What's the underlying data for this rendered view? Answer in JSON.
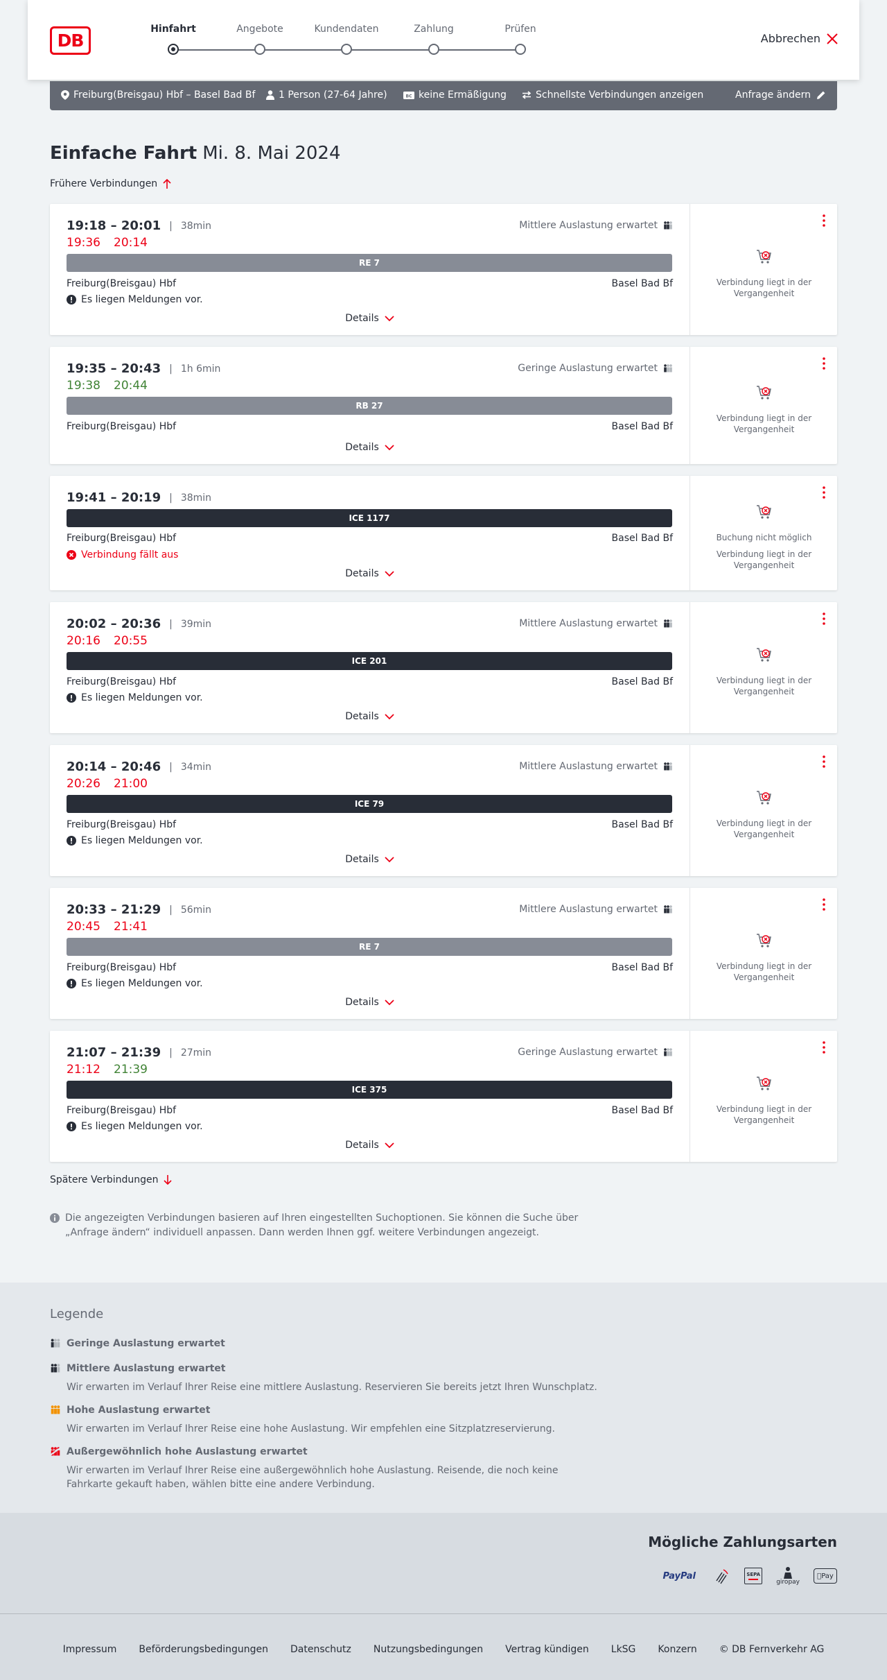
{
  "header": {
    "logo": "DB",
    "steps": [
      "Hinfahrt",
      "Angebote",
      "Kundendaten",
      "Zahlung",
      "Prüfen"
    ],
    "active_step": "Hinfahrt",
    "cancel_label": "Abbrechen"
  },
  "query": {
    "route": "Freiburg(Breisgau) Hbf – Basel Bad Bf",
    "passengers": "1 Person (27-64 Jahre)",
    "discount": "keine Ermäßigung",
    "fastest": "Schnellste Verbindungen anzeigen",
    "edit_label": "Anfrage ändern"
  },
  "title": {
    "trip_type": "Einfache Fahrt",
    "date": "Mi. 8. Mai 2024"
  },
  "earlier_label": "Frühere Verbindungen",
  "later_label": "Spätere Verbindungen",
  "details_label": "Details",
  "connections": [
    {
      "times": "19:18 – 20:01",
      "duration": "38min",
      "rt_dep": "19:36",
      "rt_arr": "20:14",
      "rt_color": "red",
      "load": "Mittlere Auslastung erwartet",
      "train": "RE 7",
      "train_style": "grey",
      "from": "Freiburg(Breisgau) Hbf",
      "to": "Basel Bad Bf",
      "msg": "Es liegen Meldungen vor.",
      "side": "Verbindung liegt in der Vergangenheit"
    },
    {
      "times": "19:35 – 20:43",
      "duration": "1h 6min",
      "rt_dep": "19:38",
      "rt_arr": "20:44",
      "rt_color": "green",
      "load": "Geringe Auslastung erwartet",
      "train": "RB 27",
      "train_style": "grey",
      "from": "Freiburg(Breisgau) Hbf",
      "to": "Basel Bad Bf",
      "side": "Verbindung liegt in der Vergangenheit"
    },
    {
      "times": "19:41 – 20:19",
      "duration": "38min",
      "train": "ICE 1177",
      "train_style": "dark",
      "from": "Freiburg(Breisgau) Hbf",
      "to": "Basel Bad Bf",
      "msg": "Verbindung fällt aus",
      "side_top": "Buchung nicht möglich",
      "side": "Verbindung liegt in der Vergangenheit"
    },
    {
      "times": "20:02 – 20:36",
      "duration": "39min",
      "rt_dep": "20:16",
      "rt_arr": "20:55",
      "rt_color": "red",
      "load": "Mittlere Auslastung erwartet",
      "train": "ICE 201",
      "train_style": "dark",
      "from": "Freiburg(Breisgau) Hbf",
      "to": "Basel Bad Bf",
      "msg": "Es liegen Meldungen vor.",
      "side": "Verbindung liegt in der Vergangenheit"
    },
    {
      "times": "20:14 – 20:46",
      "duration": "34min",
      "rt_dep": "20:26",
      "rt_arr": "21:00",
      "rt_color": "red",
      "load": "Mittlere Auslastung erwartet",
      "train": "ICE 79",
      "train_style": "dark",
      "from": "Freiburg(Breisgau) Hbf",
      "to": "Basel Bad Bf",
      "msg": "Es liegen Meldungen vor.",
      "side": "Verbindung liegt in der Vergangenheit"
    },
    {
      "times": "20:33 – 21:29",
      "duration": "56min",
      "rt_dep": "20:45",
      "rt_arr": "21:41",
      "rt_color": "red",
      "load": "Mittlere Auslastung erwartet",
      "train": "RE 7",
      "train_style": "grey",
      "from": "Freiburg(Breisgau) Hbf",
      "to": "Basel Bad Bf",
      "msg": "Es liegen Meldungen vor.",
      "side": "Verbindung liegt in der Vergangenheit"
    },
    {
      "times": "21:07 – 21:39",
      "duration": "27min",
      "rt_dep": "21:12",
      "rt_arr": "21:39",
      "rt_color": "mixed",
      "load": "Geringe Auslastung erwartet",
      "train": "ICE 375",
      "train_style": "dark",
      "from": "Freiburg(Breisgau) Hbf",
      "to": "Basel Bad Bf",
      "msg": "Es liegen Meldungen vor.",
      "side": "Verbindung liegt in der Vergangenheit"
    }
  ],
  "info_note": "Die angezeigten Verbindungen basieren auf Ihren eingestellten Suchoptionen. Sie können die Suche über „Anfrage ändern“ individuell anpassen. Dann werden Ihnen ggf. weitere Verbindungen angezeigt.",
  "legend": {
    "title": "Legende",
    "items": [
      {
        "title": "Geringe Auslastung erwartet",
        "desc": ""
      },
      {
        "title": "Mittlere Auslastung erwartet",
        "desc": "Wir erwarten im Verlauf Ihrer Reise eine mittlere Auslastung. Reservieren Sie bereits jetzt Ihren Wunschplatz."
      },
      {
        "title": "Hohe Auslastung erwartet",
        "desc": "Wir erwarten im Verlauf Ihrer Reise eine hohe Auslastung. Wir empfehlen eine Sitzplatzreservierung."
      },
      {
        "title": "Außergewöhnlich hohe Auslastung erwartet",
        "desc": "Wir erwarten im Verlauf Ihrer Reise eine außergewöhnlich hohe Auslastung. Reisende, die noch keine Fahrkarte gekauft haben, wählen bitte eine andere Verbindung."
      }
    ]
  },
  "payment": {
    "title": "Mögliche Zahlungsarten",
    "paypal": "PayPal",
    "sepa": "SEPA",
    "giropay": "giropay",
    "applepay": "Pay"
  },
  "footer": [
    "Impressum",
    "Beförderungsbedingungen",
    "Datenschutz",
    "Nutzungsbedingungen",
    "Vertrag kündigen",
    "LkSG",
    "Konzern",
    "© DB Fernverkehr AG"
  ],
  "colors": {
    "db_red": "#ec0016",
    "delay_red": "#ec0016",
    "ontime_green": "#408335",
    "query_bar": "#646973",
    "dark_train": "#282d37",
    "grey_train": "#878c96",
    "load_high": "#f39200"
  }
}
